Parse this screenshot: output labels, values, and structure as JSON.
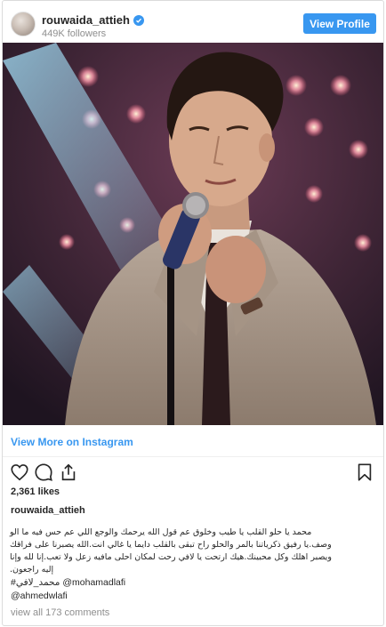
{
  "header": {
    "username": "rouwaida_attieh",
    "followers": "449K followers",
    "view_profile_label": "View Profile"
  },
  "post": {
    "view_more_label": "View More on Instagram",
    "likes": "2,361 likes",
    "caption_username": "rouwaida_attieh",
    "caption_lines": [
      "محمد يا حلو القلب يا طيب وخلوق عم قول الله يرحمك والوجع اللي عم حس فيه ما الو",
      "وصف.يا رفيق ذكرياتنا بالمر والحلو راح تبقى بالقلب دايما يا غالي انت.الله يصبرنا على فراقك",
      "ويصبر اهلك وكل محبينك.هيك ارتحت يا لافي رحت لمكان احلى مافيه زعل ولا تعب.إنا لله وإنا",
      "إليه راجعون."
    ],
    "hashtag_line": "#محمد_لافي @mohamadlafi",
    "mention_line": "@ahmedwlafi",
    "comments_label": "view all 173 comments"
  },
  "icons": {
    "verified": "verified-badge-icon",
    "like": "heart-icon",
    "comment": "comment-bubble-icon",
    "share": "share-icon",
    "save": "bookmark-icon"
  },
  "colors": {
    "accent": "#3897f0",
    "text": "#262626",
    "muted": "#8e8e8e"
  }
}
